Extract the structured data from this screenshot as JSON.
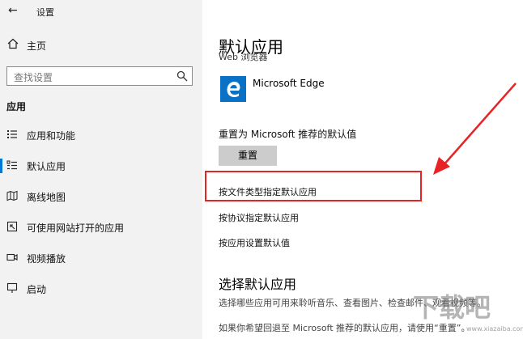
{
  "window": {
    "title": "设置"
  },
  "sidebar": {
    "home_label": "主页",
    "search_placeholder": "查找设置",
    "section_label": "应用",
    "items": [
      {
        "label": "应用和功能",
        "icon": "apps-list-icon",
        "active": false
      },
      {
        "label": "默认应用",
        "icon": "default-apps-icon",
        "active": true
      },
      {
        "label": "离线地图",
        "icon": "offline-map-icon",
        "active": false
      },
      {
        "label": "可使用网站打开的应用",
        "icon": "web-apps-icon",
        "active": false
      },
      {
        "label": "视频播放",
        "icon": "video-icon",
        "active": false
      },
      {
        "label": "启动",
        "icon": "startup-icon",
        "active": false
      }
    ]
  },
  "main": {
    "title": "默认应用",
    "clipped_label": "Web 浏览器",
    "default_app": {
      "name": "Microsoft Edge",
      "icon": "edge-icon"
    },
    "reset_label": "重置为 Microsoft 推荐的默认值",
    "reset_button": "重置",
    "links": [
      "按文件类型指定默认应用",
      "按协议指定默认应用",
      "按应用设置默认值"
    ],
    "choose_title": "选择默认应用",
    "choose_desc": "选择哪些应用可用来聆听音乐、查看图片、检查邮件、观看视频等。",
    "choose_desc2": "如果你希望回退至 Microsoft 推荐的默认应用，请使用“重置”。"
  },
  "annotation": {
    "highlight_color": "#e82323",
    "watermark": "下载吧",
    "watermark_sub": "www.xiazaiba.com"
  }
}
